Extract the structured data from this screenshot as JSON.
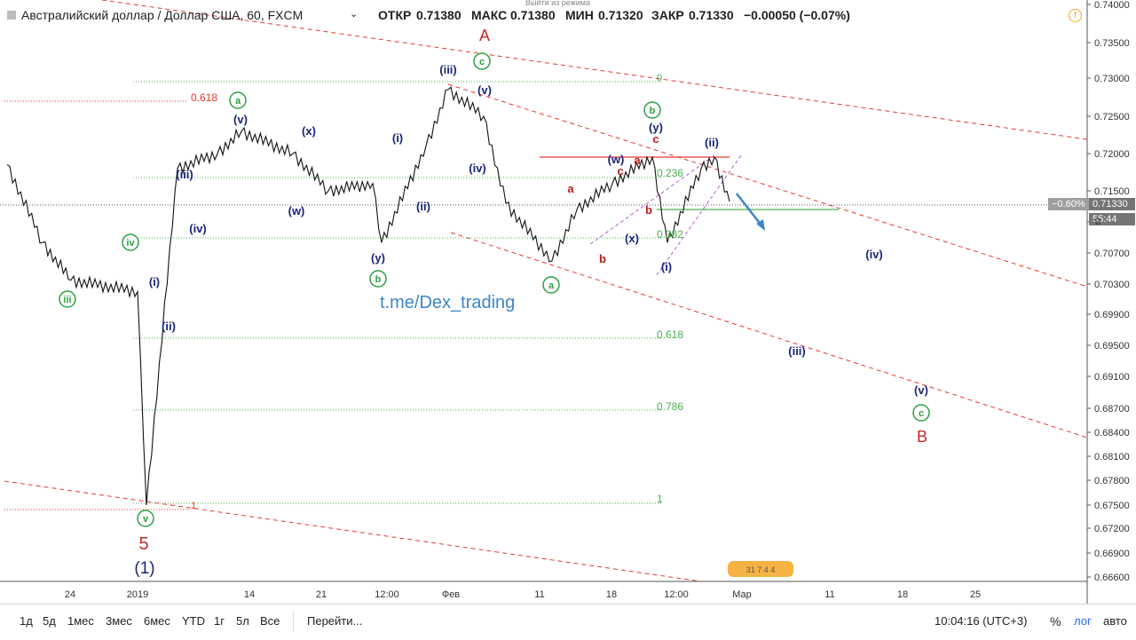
{
  "header": {
    "title": "Австралийский доллар / Доллар США, 60, FXCM",
    "open_label": "ОТКР",
    "open_value": "0.71380",
    "high_label": "МАКС",
    "high_value": "0.71380",
    "low_label": "МИН",
    "low_value": "0.71320",
    "close_label": "ЗАКР",
    "close_value": "0.71330",
    "change": "−0.00050 (−0.07%)",
    "exit_mode": "Выйти из режима"
  },
  "price_axis": {
    "ticks": [
      "0.74000",
      "0.73500",
      "0.73000",
      "0.72500",
      "0.72000",
      "0.71500",
      "0.71000",
      "0.70700",
      "0.70300",
      "0.69900",
      "0.69500",
      "0.69100",
      "0.68700",
      "0.68400",
      "0.68100",
      "0.67800",
      "0.67500",
      "0.67200",
      "0.66900",
      "0.66600"
    ],
    "current_price": "0.71330",
    "current_pct": "−0.60%",
    "countdown": "55:44",
    "zero_label": "0"
  },
  "time_axis": [
    "24",
    "2019",
    "14",
    "21",
    "12:00",
    "Фев",
    "11",
    "18",
    "12:00",
    "Мар",
    "11",
    "18",
    "25"
  ],
  "fib_levels": {
    "left_618": "0.618",
    "left_1": "1",
    "l0": "0",
    "l236": "0.236",
    "l382": "0.382",
    "l618": "0.618",
    "l786": "0.786",
    "l1": "1"
  },
  "watermark": "t.me/Dex_trading",
  "waves": {
    "iii_g": "iii",
    "iv_g": "iv",
    "v_g": "v",
    "a_g1": "a",
    "b_g1": "b",
    "c_g1": "c",
    "a_g2": "a",
    "b_g2": "b",
    "c_g3": "c",
    "five": "5",
    "one_big": "(1)",
    "i1": "(i)",
    "ii1": "(ii)",
    "iii1": "(iii)",
    "iv1": "(iv)",
    "v1": "(v)",
    "x1": "(x)",
    "w1": "(w)",
    "y1": "(y)",
    "i2": "(i)",
    "ii2": "(ii)",
    "iii_top": "(iii)",
    "v_top": "(v)",
    "iv_top": "(iv)",
    "w2": "(w)",
    "x2": "(x)",
    "y2": "(y)",
    "i3": "(i)",
    "ii3": "(ii)",
    "iii_proj": "(iii)",
    "iv_proj": "(iv)",
    "v_proj": "(v)",
    "A": "A",
    "B": "B",
    "ra1": "a",
    "rb1": "b",
    "rc1": "c",
    "ra2": "a",
    "rb2": "b",
    "rc2": "c"
  },
  "toolbar": {
    "periods": [
      "1д",
      "5д",
      "1мес",
      "3мес",
      "6мес",
      "YTD",
      "1г",
      "5л",
      "Все"
    ],
    "goto": "Перейти...",
    "time": "10:04:16 (UTC+3)",
    "percent": "%",
    "log": "лог",
    "auto": "авто"
  },
  "chart_data": {
    "type": "line",
    "title": "Австралийский доллар / Доллар США, 60, FXCM",
    "x": [
      "Dec 21",
      "Dec 24",
      "Dec 28",
      "Jan 2",
      "Jan 3",
      "Jan 7",
      "Jan 10",
      "Jan 14",
      "Jan 18",
      "Jan 21",
      "Jan 24",
      "Jan 28",
      "Jan 30",
      "Feb 1",
      "Feb 4",
      "Feb 7",
      "Feb 11",
      "Feb 13",
      "Feb 18",
      "Feb 20",
      "Feb 21",
      "Feb 22",
      "Feb 25",
      "Feb 26"
    ],
    "y": [
      0.7185,
      0.708,
      0.7035,
      0.702,
      0.675,
      0.718,
      0.72,
      0.723,
      0.72,
      0.715,
      0.716,
      0.708,
      0.721,
      0.7285,
      0.725,
      0.713,
      0.706,
      0.712,
      0.716,
      0.7195,
      0.708,
      0.718,
      0.7195,
      0.7133
    ],
    "ylim": [
      0.666,
      0.74
    ],
    "grid": false
  }
}
